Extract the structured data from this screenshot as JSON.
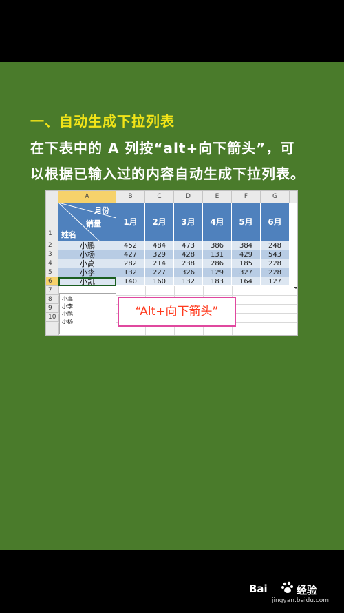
{
  "heading": "一、自动生成下拉列表",
  "description": {
    "line1": "在下表中的 A 列按“alt+向下箭头”，可",
    "line2": "以根据已输入过的内容自动生成下拉列表。"
  },
  "sheet": {
    "columns": [
      "A",
      "B",
      "C",
      "D",
      "E",
      "F",
      "G"
    ],
    "rows": [
      "1",
      "2",
      "3",
      "4",
      "5",
      "6",
      "7",
      "8",
      "9",
      "10"
    ],
    "header_diag": {
      "top": "月份",
      "mid": "销量",
      "bottom": "姓名"
    },
    "months": [
      "1月",
      "2月",
      "3月",
      "4月",
      "5月",
      "6月"
    ],
    "data": [
      {
        "name": "小鹏",
        "values": [
          "452",
          "484",
          "473",
          "386",
          "384",
          "248"
        ]
      },
      {
        "name": "小杨",
        "values": [
          "427",
          "329",
          "428",
          "131",
          "429",
          "543"
        ]
      },
      {
        "name": "小高",
        "values": [
          "282",
          "214",
          "238",
          "286",
          "185",
          "228"
        ]
      },
      {
        "name": "小李",
        "values": [
          "132",
          "227",
          "326",
          "129",
          "327",
          "228"
        ]
      },
      {
        "name": "小凯",
        "values": [
          "140",
          "160",
          "132",
          "183",
          "164",
          "127"
        ]
      }
    ],
    "dropdown_items": [
      "小高",
      "小李",
      "小鹏",
      "小杨"
    ],
    "callout": "“Alt+向下箭头”"
  },
  "watermark": {
    "brand_a": "Bai",
    "brand_b": "经验",
    "site": "jingyan.baidu.com"
  },
  "colors": {
    "panel": "#4a7b2b",
    "heading": "#f2e418",
    "table_header": "#4f81bd",
    "callout_border": "#e0489f",
    "callout_text": "#ff3b1f"
  }
}
